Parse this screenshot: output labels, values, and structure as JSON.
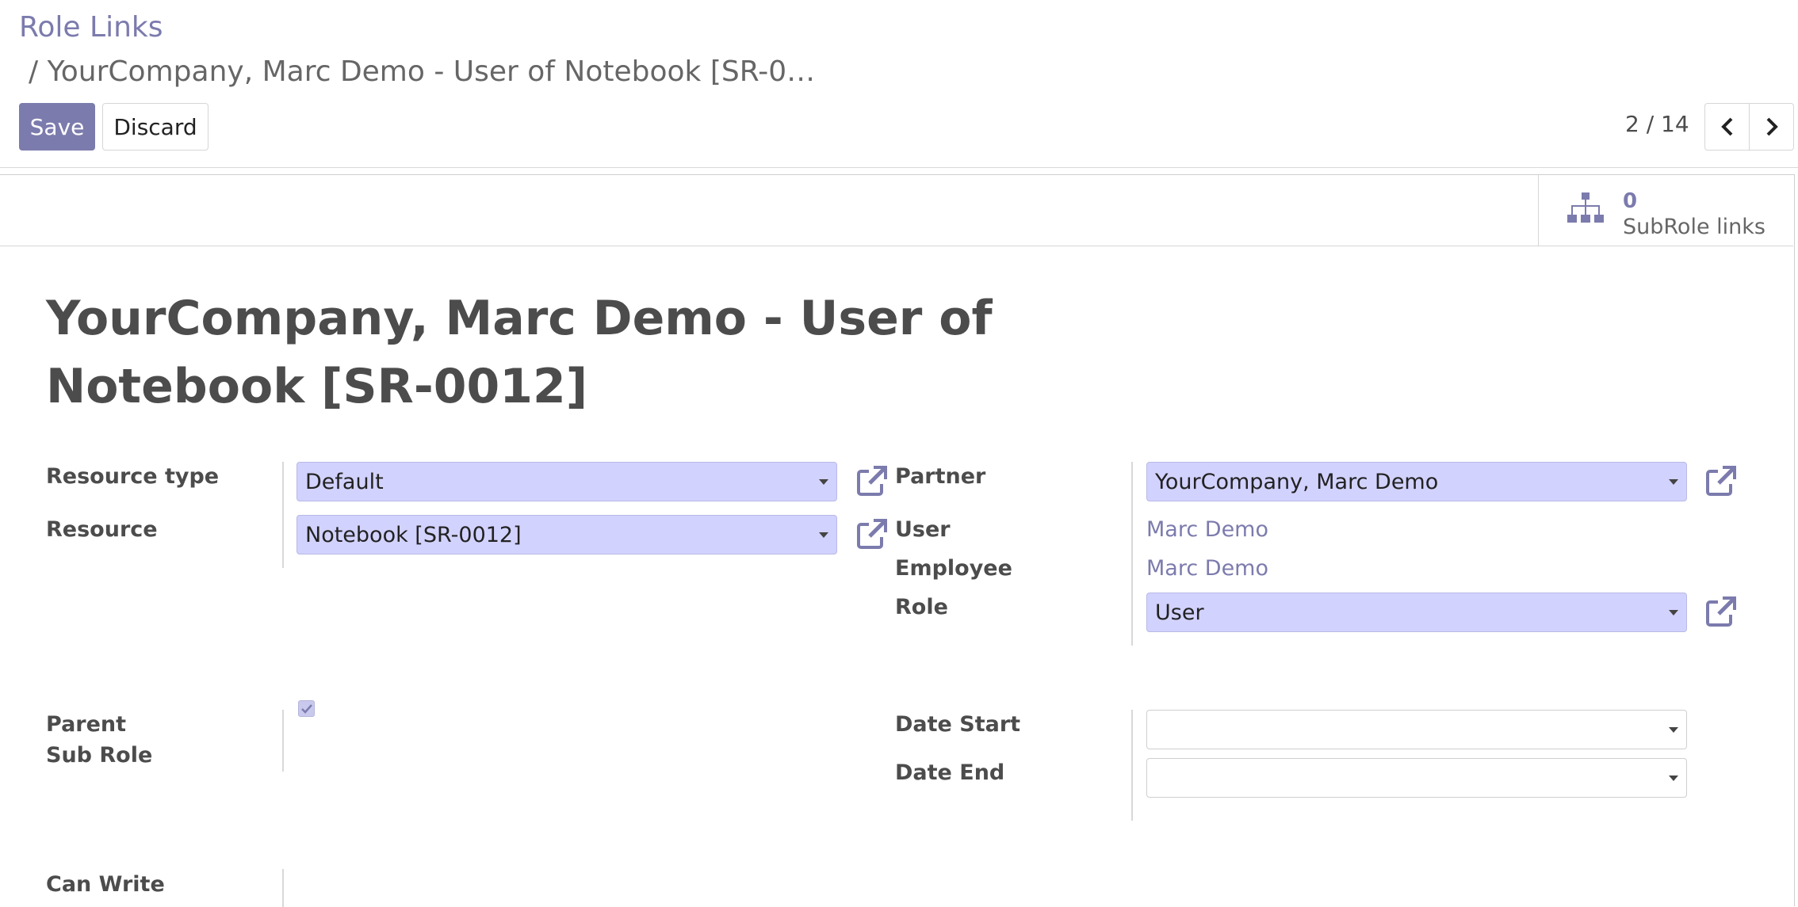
{
  "breadcrumb": {
    "root": "Role Links",
    "current": "/ YourCompany, Marc Demo - User of Notebook [SR-0…"
  },
  "toolbar": {
    "save_label": "Save",
    "discard_label": "Discard"
  },
  "pager": {
    "value": "2 / 14",
    "prev_icon": "chevron-left-icon",
    "next_icon": "chevron-right-icon"
  },
  "stat_button": {
    "value": "0",
    "label": "SubRole links",
    "icon": "sitemap-icon"
  },
  "record": {
    "title": "YourCompany, Marc Demo - User of Notebook [SR-0012]"
  },
  "fields": {
    "resource_type": {
      "label": "Resource type",
      "value": "Default"
    },
    "resource": {
      "label": "Resource",
      "value": "Notebook [SR-0012]"
    },
    "partner": {
      "label": "Partner",
      "value": "YourCompany, Marc Demo"
    },
    "user": {
      "label": "User",
      "value": "Marc Demo"
    },
    "employee": {
      "label": "Employee",
      "value": "Marc Demo"
    },
    "role": {
      "label": "Role",
      "value": "User"
    },
    "parent": {
      "label": "Parent"
    },
    "sub_role": {
      "label": "Sub Role"
    },
    "date_start": {
      "label": "Date Start",
      "value": ""
    },
    "date_end": {
      "label": "Date End",
      "value": ""
    },
    "can_write": {
      "label": "Can Write",
      "checked": true
    }
  },
  "colors": {
    "brand": "#7c7bad",
    "select_bg": "#d2d2ff"
  }
}
